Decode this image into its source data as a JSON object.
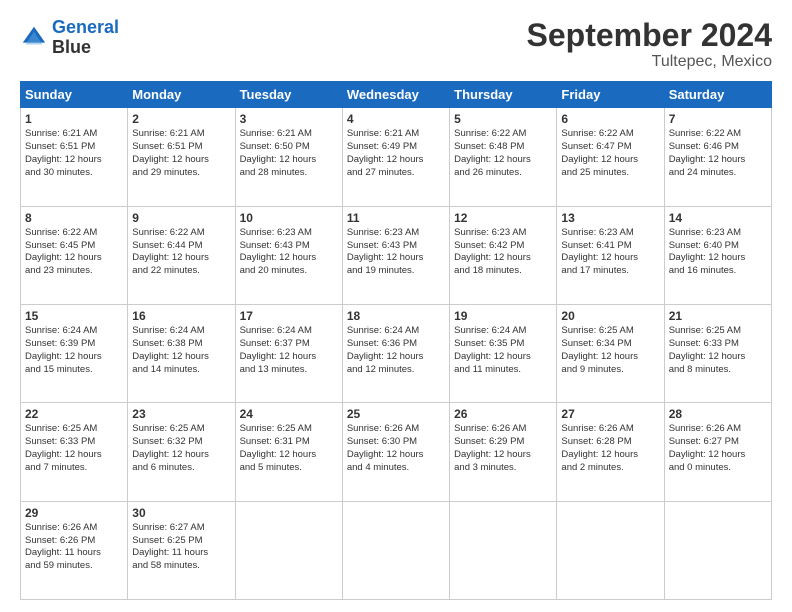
{
  "header": {
    "logo_line1": "General",
    "logo_line2": "Blue",
    "month": "September 2024",
    "location": "Tultepec, Mexico"
  },
  "days_of_week": [
    "Sunday",
    "Monday",
    "Tuesday",
    "Wednesday",
    "Thursday",
    "Friday",
    "Saturday"
  ],
  "weeks": [
    [
      {
        "day": "1",
        "lines": [
          "Sunrise: 6:21 AM",
          "Sunset: 6:51 PM",
          "Daylight: 12 hours",
          "and 30 minutes."
        ]
      },
      {
        "day": "2",
        "lines": [
          "Sunrise: 6:21 AM",
          "Sunset: 6:51 PM",
          "Daylight: 12 hours",
          "and 29 minutes."
        ]
      },
      {
        "day": "3",
        "lines": [
          "Sunrise: 6:21 AM",
          "Sunset: 6:50 PM",
          "Daylight: 12 hours",
          "and 28 minutes."
        ]
      },
      {
        "day": "4",
        "lines": [
          "Sunrise: 6:21 AM",
          "Sunset: 6:49 PM",
          "Daylight: 12 hours",
          "and 27 minutes."
        ]
      },
      {
        "day": "5",
        "lines": [
          "Sunrise: 6:22 AM",
          "Sunset: 6:48 PM",
          "Daylight: 12 hours",
          "and 26 minutes."
        ]
      },
      {
        "day": "6",
        "lines": [
          "Sunrise: 6:22 AM",
          "Sunset: 6:47 PM",
          "Daylight: 12 hours",
          "and 25 minutes."
        ]
      },
      {
        "day": "7",
        "lines": [
          "Sunrise: 6:22 AM",
          "Sunset: 6:46 PM",
          "Daylight: 12 hours",
          "and 24 minutes."
        ]
      }
    ],
    [
      {
        "day": "8",
        "lines": [
          "Sunrise: 6:22 AM",
          "Sunset: 6:45 PM",
          "Daylight: 12 hours",
          "and 23 minutes."
        ]
      },
      {
        "day": "9",
        "lines": [
          "Sunrise: 6:22 AM",
          "Sunset: 6:44 PM",
          "Daylight: 12 hours",
          "and 22 minutes."
        ]
      },
      {
        "day": "10",
        "lines": [
          "Sunrise: 6:23 AM",
          "Sunset: 6:43 PM",
          "Daylight: 12 hours",
          "and 20 minutes."
        ]
      },
      {
        "day": "11",
        "lines": [
          "Sunrise: 6:23 AM",
          "Sunset: 6:43 PM",
          "Daylight: 12 hours",
          "and 19 minutes."
        ]
      },
      {
        "day": "12",
        "lines": [
          "Sunrise: 6:23 AM",
          "Sunset: 6:42 PM",
          "Daylight: 12 hours",
          "and 18 minutes."
        ]
      },
      {
        "day": "13",
        "lines": [
          "Sunrise: 6:23 AM",
          "Sunset: 6:41 PM",
          "Daylight: 12 hours",
          "and 17 minutes."
        ]
      },
      {
        "day": "14",
        "lines": [
          "Sunrise: 6:23 AM",
          "Sunset: 6:40 PM",
          "Daylight: 12 hours",
          "and 16 minutes."
        ]
      }
    ],
    [
      {
        "day": "15",
        "lines": [
          "Sunrise: 6:24 AM",
          "Sunset: 6:39 PM",
          "Daylight: 12 hours",
          "and 15 minutes."
        ]
      },
      {
        "day": "16",
        "lines": [
          "Sunrise: 6:24 AM",
          "Sunset: 6:38 PM",
          "Daylight: 12 hours",
          "and 14 minutes."
        ]
      },
      {
        "day": "17",
        "lines": [
          "Sunrise: 6:24 AM",
          "Sunset: 6:37 PM",
          "Daylight: 12 hours",
          "and 13 minutes."
        ]
      },
      {
        "day": "18",
        "lines": [
          "Sunrise: 6:24 AM",
          "Sunset: 6:36 PM",
          "Daylight: 12 hours",
          "and 12 minutes."
        ]
      },
      {
        "day": "19",
        "lines": [
          "Sunrise: 6:24 AM",
          "Sunset: 6:35 PM",
          "Daylight: 12 hours",
          "and 11 minutes."
        ]
      },
      {
        "day": "20",
        "lines": [
          "Sunrise: 6:25 AM",
          "Sunset: 6:34 PM",
          "Daylight: 12 hours",
          "and 9 minutes."
        ]
      },
      {
        "day": "21",
        "lines": [
          "Sunrise: 6:25 AM",
          "Sunset: 6:33 PM",
          "Daylight: 12 hours",
          "and 8 minutes."
        ]
      }
    ],
    [
      {
        "day": "22",
        "lines": [
          "Sunrise: 6:25 AM",
          "Sunset: 6:33 PM",
          "Daylight: 12 hours",
          "and 7 minutes."
        ]
      },
      {
        "day": "23",
        "lines": [
          "Sunrise: 6:25 AM",
          "Sunset: 6:32 PM",
          "Daylight: 12 hours",
          "and 6 minutes."
        ]
      },
      {
        "day": "24",
        "lines": [
          "Sunrise: 6:25 AM",
          "Sunset: 6:31 PM",
          "Daylight: 12 hours",
          "and 5 minutes."
        ]
      },
      {
        "day": "25",
        "lines": [
          "Sunrise: 6:26 AM",
          "Sunset: 6:30 PM",
          "Daylight: 12 hours",
          "and 4 minutes."
        ]
      },
      {
        "day": "26",
        "lines": [
          "Sunrise: 6:26 AM",
          "Sunset: 6:29 PM",
          "Daylight: 12 hours",
          "and 3 minutes."
        ]
      },
      {
        "day": "27",
        "lines": [
          "Sunrise: 6:26 AM",
          "Sunset: 6:28 PM",
          "Daylight: 12 hours",
          "and 2 minutes."
        ]
      },
      {
        "day": "28",
        "lines": [
          "Sunrise: 6:26 AM",
          "Sunset: 6:27 PM",
          "Daylight: 12 hours",
          "and 0 minutes."
        ]
      }
    ],
    [
      {
        "day": "29",
        "lines": [
          "Sunrise: 6:26 AM",
          "Sunset: 6:26 PM",
          "Daylight: 11 hours",
          "and 59 minutes."
        ]
      },
      {
        "day": "30",
        "lines": [
          "Sunrise: 6:27 AM",
          "Sunset: 6:25 PM",
          "Daylight: 11 hours",
          "and 58 minutes."
        ]
      },
      {
        "day": "",
        "lines": []
      },
      {
        "day": "",
        "lines": []
      },
      {
        "day": "",
        "lines": []
      },
      {
        "day": "",
        "lines": []
      },
      {
        "day": "",
        "lines": []
      }
    ]
  ]
}
